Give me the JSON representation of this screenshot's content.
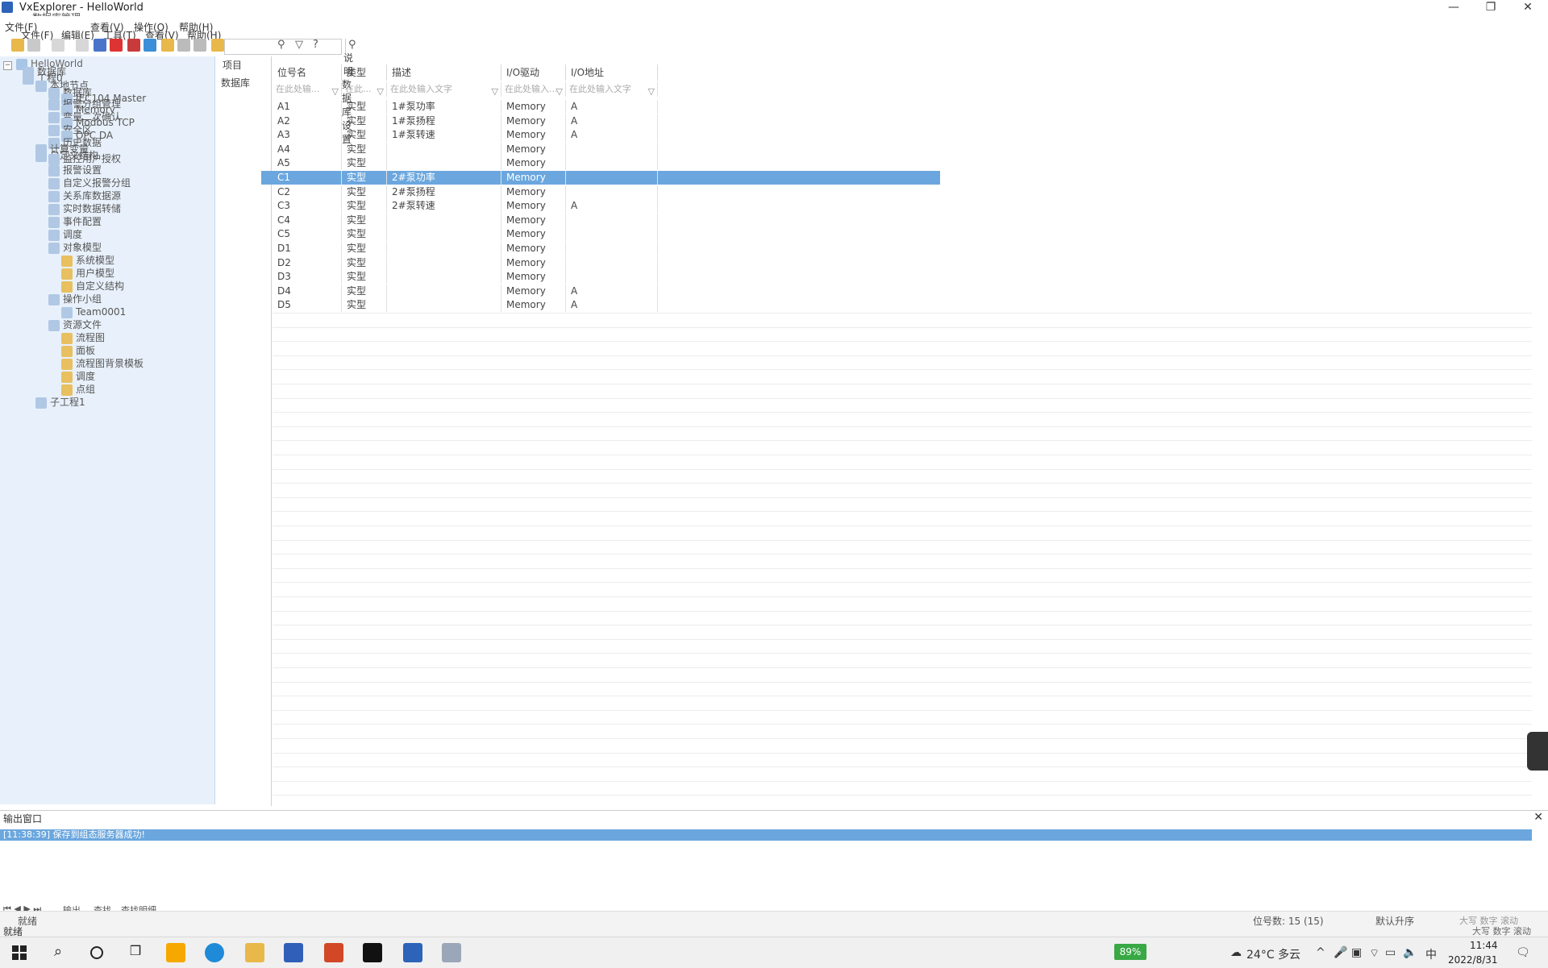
{
  "window": {
    "title": "VxExplorer - HelloWorld",
    "overlay_title": "数据库管理",
    "min": "—",
    "max": "❐",
    "close": "✕"
  },
  "menu": {
    "back": [
      "文件(F)",
      "查看(V)",
      "操作(O)",
      "帮助(H)"
    ],
    "front": [
      "文件(F)",
      "编辑(E)",
      "工具(T)",
      "查看(V)",
      "帮助(H)"
    ]
  },
  "tree": {
    "root": "HelloWorld",
    "items": [
      {
        "label": "数据库",
        "level": 1
      },
      {
        "label": "工程0",
        "level": 1
      },
      {
        "label": "本地节点",
        "level": 2
      },
      {
        "label": "数据库",
        "level": 3
      },
      {
        "label": "IEC104 Master",
        "level": 4
      },
      {
        "label": "报警分组管理",
        "level": 3
      },
      {
        "label": "Memory",
        "level": 4
      },
      {
        "label": "变量二次确认",
        "level": 3
      },
      {
        "label": "Modbus TCP",
        "level": 4
      },
      {
        "label": "安全区",
        "level": 3
      },
      {
        "label": "OPC DA",
        "level": 4
      },
      {
        "label": "历史数据",
        "level": 3
      },
      {
        "label": "计算变量",
        "level": 2
      },
      {
        "label": "自定义结构",
        "level": 2
      },
      {
        "label": "监控用户授权",
        "level": 3
      },
      {
        "label": "报警设置",
        "level": 3
      },
      {
        "label": "自定义报警分组",
        "level": 3
      },
      {
        "label": "关系库数据源",
        "level": 3
      },
      {
        "label": "实时数据转储",
        "level": 3
      },
      {
        "label": "事件配置",
        "level": 3
      },
      {
        "label": "调度",
        "level": 3
      },
      {
        "label": "对象模型",
        "level": 3
      },
      {
        "label": "系统模型",
        "level": 4
      },
      {
        "label": "用户模型",
        "level": 4
      },
      {
        "label": "自定义结构",
        "level": 4
      },
      {
        "label": "操作小组",
        "level": 3
      },
      {
        "label": "Team0001",
        "level": 4
      },
      {
        "label": "资源文件",
        "level": 3
      },
      {
        "label": "流程图",
        "level": 4
      },
      {
        "label": "面板",
        "level": 4
      },
      {
        "label": "流程图背景模板",
        "level": 4
      },
      {
        "label": "调度",
        "level": 4
      },
      {
        "label": "点组",
        "level": 4
      },
      {
        "label": "子工程1",
        "level": 2
      }
    ]
  },
  "midpanel": {
    "header": "项目",
    "header2": "说明",
    "row": "数据库",
    "row2": "数据库设置"
  },
  "grid": {
    "columns": [
      "位号名",
      "类型",
      "描述",
      "I/O驱动",
      "I/O地址"
    ],
    "filters": [
      "在此处输...",
      "在此...",
      "在此处输入文字",
      "在此处输入...",
      "在此处输入文字"
    ],
    "rows": [
      [
        "A1",
        "实型",
        "1#泵功率",
        "Memory",
        "A"
      ],
      [
        "A2",
        "实型",
        "1#泵扬程",
        "Memory",
        "A"
      ],
      [
        "A3",
        "实型",
        "1#泵转速",
        "Memory",
        "A"
      ],
      [
        "A4",
        "实型",
        "",
        "Memory",
        ""
      ],
      [
        "A5",
        "实型",
        "",
        "Memory",
        ""
      ],
      [
        "C1",
        "实型",
        "2#泵功率",
        "Memory",
        ""
      ],
      [
        "C2",
        "实型",
        "2#泵扬程",
        "Memory",
        ""
      ],
      [
        "C3",
        "实型",
        "2#泵转速",
        "Memory",
        "A"
      ],
      [
        "C4",
        "实型",
        "",
        "Memory",
        ""
      ],
      [
        "C5",
        "实型",
        "",
        "Memory",
        ""
      ],
      [
        "D1",
        "实型",
        "",
        "Memory",
        ""
      ],
      [
        "D2",
        "实型",
        "",
        "Memory",
        ""
      ],
      [
        "D3",
        "实型",
        "",
        "Memory",
        ""
      ],
      [
        "D4",
        "实型",
        "",
        "Memory",
        "A"
      ],
      [
        "D5",
        "实型",
        "",
        "Memory",
        "A"
      ]
    ],
    "selected_index": 5
  },
  "output": {
    "header": "输出窗口",
    "close": "✕",
    "line": "[11:38:39] 保存到组态服务器成功!",
    "tabs": [
      "输出",
      "查找",
      "查找明细"
    ]
  },
  "status": {
    "left": "就绪",
    "left_under": "就绪",
    "count": "位号数: 15 (15)",
    "sort": "默认升序",
    "keys": "大写 数字 滚动",
    "keys_under": "大写 数字 滚动"
  },
  "taskbar": {
    "battery": "89%",
    "weather": "24°C 多云",
    "ime": "中",
    "time": "11:44",
    "date": "2022/8/31"
  },
  "colors": {
    "selection": "#6ba7de",
    "tree_bg": "#e8f1fb",
    "battery": "#39a845"
  }
}
